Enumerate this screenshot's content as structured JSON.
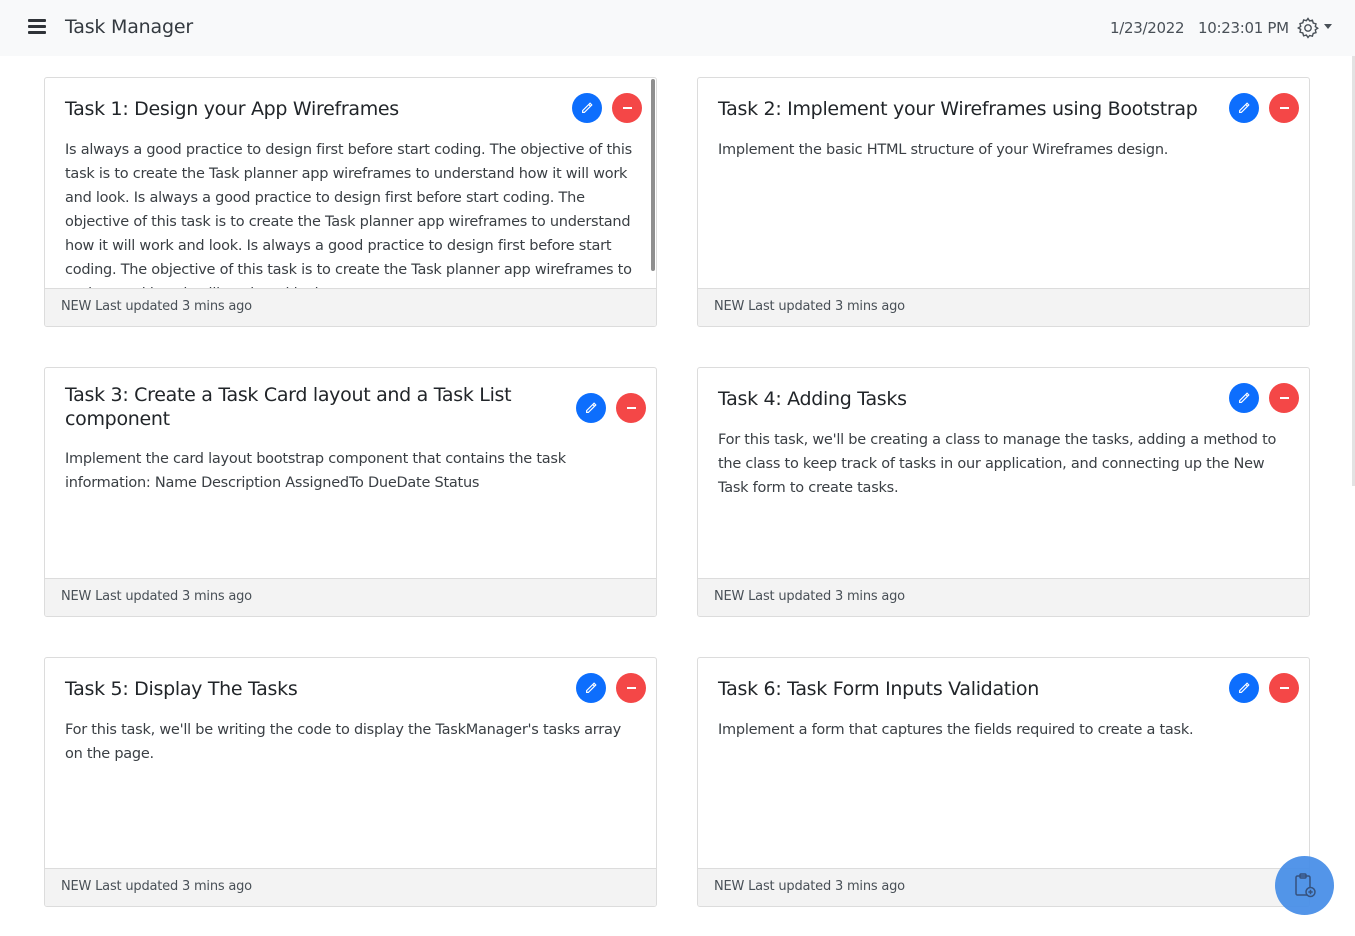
{
  "app": {
    "title": "Task Manager"
  },
  "header": {
    "date": "1/23/2022",
    "time": "10:23:01 PM"
  },
  "icons": {
    "menu": "hamburger-menu-icon",
    "settings": "gear-icon",
    "edit": "pencil-icon",
    "delete": "minus-circle-icon",
    "add_task": "clipboard-plus-icon"
  },
  "colors": {
    "edit": "#0d6efd",
    "delete": "#f44747",
    "fab": "#4a90e8"
  },
  "tasks": [
    {
      "title": "Task 1: Design your App Wireframes",
      "description": "Is always a good practice to design first before start coding. The objective of this task is to create the Task planner app wireframes to understand how it will work and look. Is always a good practice to design first before start coding. The objective of this task is to create the Task planner app wireframes to understand how it will work and look. Is always a good practice to design first before start coding. The objective of this task is to create the Task planner app wireframes to understand how it will work and look.",
      "status": "NEW",
      "updated": "Last updated 3 mins ago"
    },
    {
      "title": "Task 2: Implement your Wireframes using Bootstrap",
      "description": "Implement the basic HTML structure of your Wireframes design.",
      "status": "NEW",
      "updated": "Last updated 3 mins ago"
    },
    {
      "title": "Task 3: Create a Task Card layout and a Task List component",
      "description": "Implement the card layout bootstrap component that contains the task information: Name Description AssignedTo DueDate Status",
      "status": "NEW",
      "updated": "Last updated 3 mins ago"
    },
    {
      "title": "Task 4: Adding Tasks",
      "description": "For this task, we'll be creating a class to manage the tasks, adding a method to the class to keep track of tasks in our application, and connecting up the New Task form to create tasks.",
      "status": "NEW",
      "updated": "Last updated 3 mins ago"
    },
    {
      "title": "Task 5: Display The Tasks",
      "description": "For this task, we'll be writing the code to display the TaskManager's tasks array on the page.",
      "status": "NEW",
      "updated": "Last updated 3 mins ago"
    },
    {
      "title": "Task 6: Task Form Inputs Validation",
      "description": "Implement a form that captures the fields required to create a task.",
      "status": "NEW",
      "updated": "Last updated 3 mins ago"
    }
  ]
}
